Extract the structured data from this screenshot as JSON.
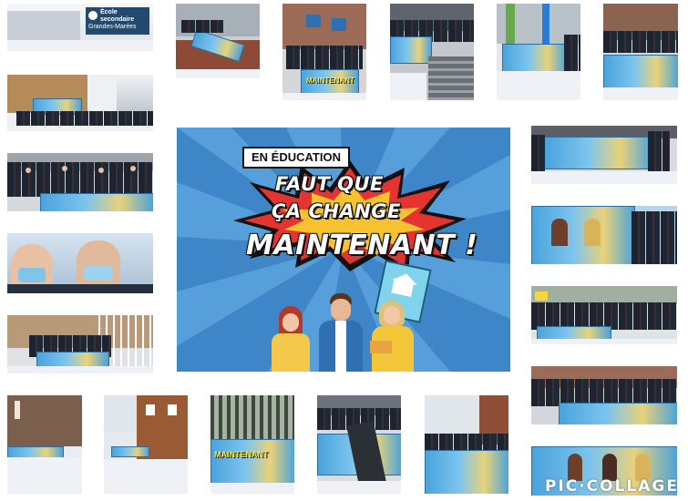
{
  "poster": {
    "tag": "EN ÉDUCATION",
    "line1": "FAUT QUE",
    "line2": "ÇA CHANGE",
    "line3": "MAINTENANT !"
  },
  "tile_texts": {
    "school_sign_1": "École",
    "school_sign_2": "secondaire",
    "school_sign_3": "Grandes-Marées",
    "maintenant_banner": "MAINTENANT"
  },
  "watermark": "PIC·COLLAGE",
  "colors": {
    "poster_blue": "#3f86c9",
    "burst_red": "#e3342f",
    "burst_yellow": "#f7c230",
    "banner_blue": "#4aa3dc"
  }
}
